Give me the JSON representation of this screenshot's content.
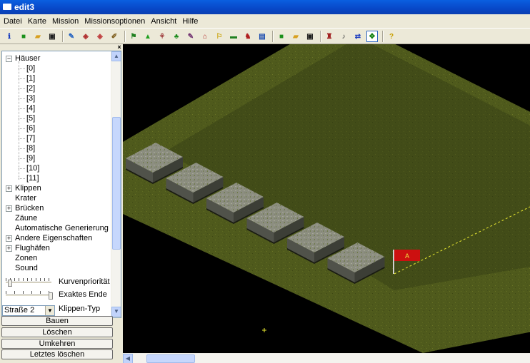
{
  "window": {
    "title": "edit3"
  },
  "menu": [
    "Datei",
    "Karte",
    "Mission",
    "Missionsoptionen",
    "Ansicht",
    "Hilfe"
  ],
  "toolbar": [
    {
      "name": "info-icon",
      "glyph": "ℹ",
      "color": "#1a3fbf"
    },
    {
      "name": "new-icon",
      "glyph": "■",
      "color": "#1a8f1a"
    },
    {
      "name": "open-icon",
      "glyph": "▰",
      "color": "#d8a020"
    },
    {
      "name": "save-icon",
      "glyph": "▣",
      "color": "#202020"
    },
    {
      "sep": true
    },
    {
      "name": "paint-terrain-icon",
      "glyph": "✎",
      "color": "#2060c0"
    },
    {
      "name": "terrain-tool-icon",
      "glyph": "◈",
      "color": "#b03030"
    },
    {
      "name": "terrain-tool-2-icon",
      "glyph": "◈",
      "color": "#c04040"
    },
    {
      "name": "edit-tool-icon",
      "glyph": "✐",
      "color": "#806020"
    },
    {
      "sep": true
    },
    {
      "name": "object-a-icon",
      "glyph": "⚑",
      "color": "#208020"
    },
    {
      "name": "object-b-icon",
      "glyph": "▲",
      "color": "#20a020"
    },
    {
      "name": "object-c-icon",
      "glyph": "⚘",
      "color": "#a04040"
    },
    {
      "name": "tree-icon",
      "glyph": "♣",
      "color": "#1a8a1a"
    },
    {
      "name": "brush-icon",
      "glyph": "✎",
      "color": "#703070"
    },
    {
      "name": "house-icon",
      "glyph": "⌂",
      "color": "#b02020"
    },
    {
      "name": "flag-icon",
      "glyph": "⚐",
      "color": "#c8a000"
    },
    {
      "name": "route-icon",
      "glyph": "▬",
      "color": "#208020"
    },
    {
      "name": "unit-icon",
      "glyph": "♞",
      "color": "#b02020"
    },
    {
      "name": "vehicle-icon",
      "glyph": "▤",
      "color": "#2050b0"
    },
    {
      "sep": true
    },
    {
      "name": "new-mission-icon",
      "glyph": "■",
      "color": "#1a8f1a"
    },
    {
      "name": "open-mission-icon",
      "glyph": "▰",
      "color": "#d8a020"
    },
    {
      "name": "save-mission-icon",
      "glyph": "▣",
      "color": "#202020"
    },
    {
      "sep": true
    },
    {
      "name": "trigger-icon",
      "glyph": "♜",
      "color": "#a02020"
    },
    {
      "name": "sound-icon",
      "glyph": "♪",
      "color": "#404040"
    },
    {
      "name": "waypoint-icon",
      "glyph": "⇄",
      "color": "#2040c0"
    },
    {
      "name": "move-icon",
      "glyph": "✥",
      "color": "#108010",
      "active": true
    },
    {
      "sep": true
    },
    {
      "name": "help-icon",
      "glyph": "?",
      "color": "#c8a000"
    }
  ],
  "tree": {
    "items": [
      {
        "label": "Häuser",
        "level": 0,
        "expander": "−"
      },
      {
        "label": "[0]",
        "level": 1
      },
      {
        "label": "[1]",
        "level": 1
      },
      {
        "label": "[2]",
        "level": 1
      },
      {
        "label": "[3]",
        "level": 1
      },
      {
        "label": "[4]",
        "level": 1
      },
      {
        "label": "[5]",
        "level": 1
      },
      {
        "label": "[6]",
        "level": 1
      },
      {
        "label": "[7]",
        "level": 1
      },
      {
        "label": "[8]",
        "level": 1
      },
      {
        "label": "[9]",
        "level": 1
      },
      {
        "label": "[10]",
        "level": 1
      },
      {
        "label": "[11]",
        "level": 1
      },
      {
        "label": "Klippen",
        "level": 0,
        "expander": "+"
      },
      {
        "label": "Krater",
        "level": 0
      },
      {
        "label": "Brücken",
        "level": 0,
        "expander": "+"
      },
      {
        "label": "Zäune",
        "level": 0
      },
      {
        "label": "Automatische Generierung",
        "level": 0
      },
      {
        "label": "Andere Eigenschaften",
        "level": 0,
        "expander": "+"
      },
      {
        "label": "Flughäfen",
        "level": 0,
        "expander": "+"
      },
      {
        "label": "Zonen",
        "level": 0
      },
      {
        "label": "Sound",
        "level": 0
      }
    ]
  },
  "controls": {
    "kurvenprioritaet_label": "Kurvenpriorität",
    "exaktes_ende_label": "Exaktes Ende",
    "klippen_typ_label": "Klippen-Typ",
    "klippen_typ_value": "Straße 2"
  },
  "buttons": [
    "Bauen",
    "Löschen",
    "Umkehren",
    "Letztes löschen"
  ],
  "map": {
    "marker_label": "A",
    "colors": {
      "grass": "#4f5a1c",
      "shadow_grass": "#3a4418",
      "flag": "#cc1010",
      "route": "#e8e830"
    }
  }
}
